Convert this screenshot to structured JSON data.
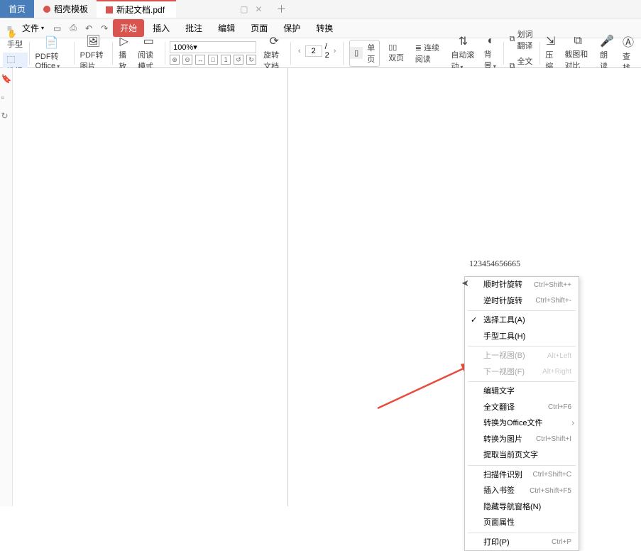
{
  "tabs": {
    "home": "首页",
    "tab1": "稻壳模板",
    "tab2": "新起文档.pdf"
  },
  "menu": {
    "file": "文件",
    "start": "开始",
    "insert": "插入",
    "annotate": "批注",
    "edit": "编辑",
    "page": "页面",
    "protect": "保护",
    "convert": "转换"
  },
  "toolbar": {
    "hand": "手型",
    "select": "选择",
    "pdf2office": "PDF转Office",
    "pdf2img": "PDF转图片",
    "play": "播放",
    "readmode": "阅读模式",
    "zoom": "100%",
    "rotate": "旋转文档",
    "page_current": "2",
    "page_total": "/ 2",
    "single": "单页",
    "double": "双页",
    "continuous": "连续阅读",
    "autoscroll": "自动滚动",
    "background": "背景",
    "wordtrans": "划词翻译",
    "fulltrans": "全文翻译",
    "compress": "压缩",
    "crop": "截图和对比",
    "read_aloud": "朗读",
    "find": "查找"
  },
  "document": {
    "body_text": "123454656665"
  },
  "context_menu": {
    "items": [
      {
        "label": "顺时针旋转",
        "shortcut": "Ctrl+Shift++"
      },
      {
        "label": "逆时针旋转",
        "shortcut": "Ctrl+Shift+-"
      },
      {
        "label": "选择工具(A)",
        "checked": true
      },
      {
        "label": "手型工具(H)"
      },
      {
        "label": "上一视图(B)",
        "shortcut": "Alt+Left",
        "disabled": true
      },
      {
        "label": "下一视图(F)",
        "shortcut": "Alt+Right",
        "disabled": true
      },
      {
        "label": "编辑文字",
        "highlight": true
      },
      {
        "label": "全文翻译",
        "shortcut": "Ctrl+F6"
      },
      {
        "label": "转换为Office文件",
        "submenu": true
      },
      {
        "label": "转换为图片",
        "shortcut": "Ctrl+Shift+I"
      },
      {
        "label": "提取当前页文字"
      },
      {
        "label": "扫描件识别",
        "shortcut": "Ctrl+Shift+C"
      },
      {
        "label": "插入书签",
        "shortcut": "Ctrl+Shift+F5"
      },
      {
        "label": "隐藏导航窗格(N)"
      },
      {
        "label": "页面属性"
      },
      {
        "label": "打印(P)",
        "shortcut": "Ctrl+P"
      }
    ]
  }
}
